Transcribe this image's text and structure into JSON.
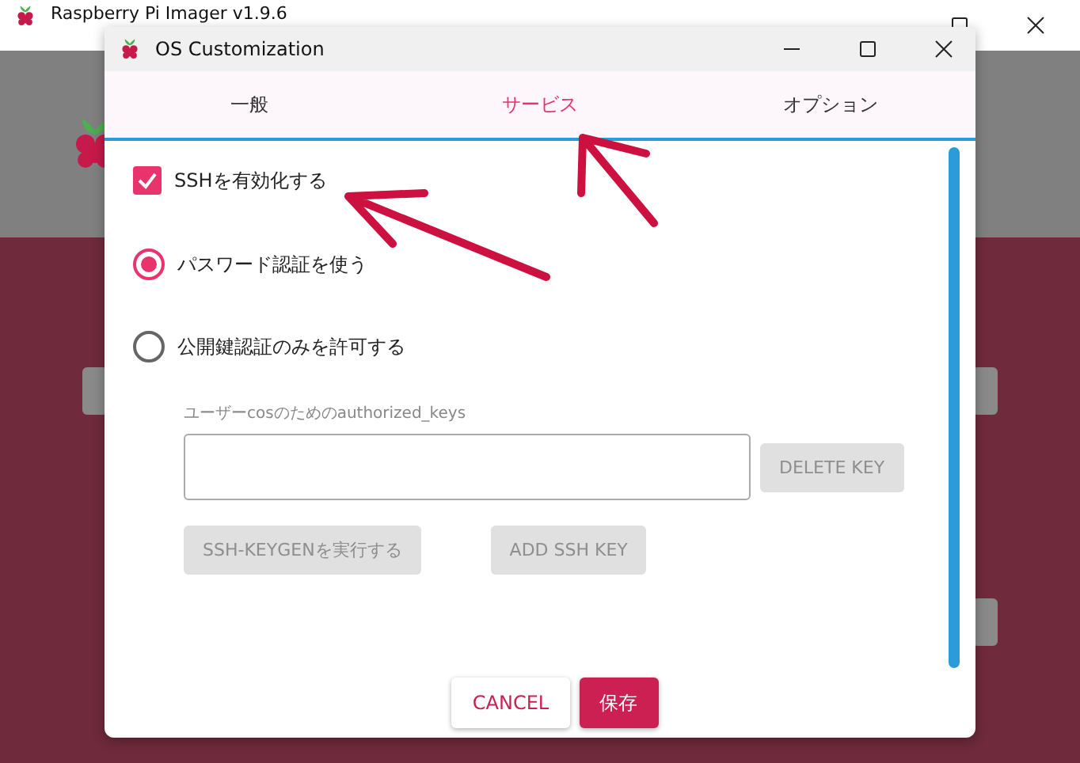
{
  "main_window": {
    "title": "Raspberry Pi Imager v1.9.6"
  },
  "dialog": {
    "title": "OS Customization",
    "tabs": [
      {
        "label": "一般",
        "selected": false
      },
      {
        "label": "サービス",
        "selected": true
      },
      {
        "label": "オプション",
        "selected": false
      }
    ],
    "enable_ssh": {
      "label": "SSHを有効化する",
      "checked": true
    },
    "auth_options": [
      {
        "label": "パスワード認証を使う",
        "selected": true
      },
      {
        "label": "公開鍵認証のみを許可する",
        "selected": false
      }
    ],
    "keys_label": "ユーザーcosのためのauthorized_keys",
    "delete_key": {
      "label": "DELETE KEY",
      "disabled": true
    },
    "key_actions": [
      {
        "label": "SSH-KEYGENを実行する",
        "disabled": true
      },
      {
        "label": "ADD SSH KEY",
        "disabled": true
      }
    ],
    "footer_buttons": [
      {
        "label": "CANCEL",
        "kind": "secondary"
      },
      {
        "label": "保存",
        "kind": "primary"
      }
    ]
  }
}
